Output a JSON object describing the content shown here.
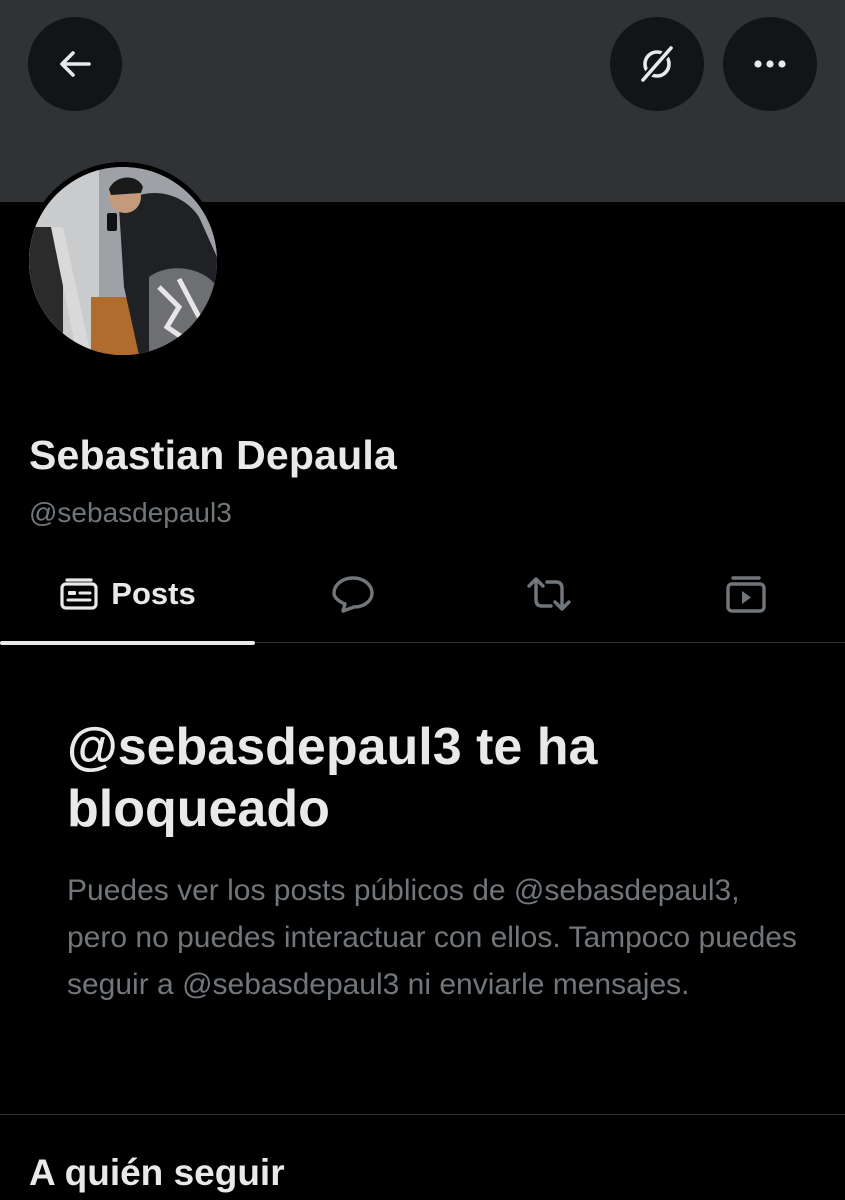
{
  "profile": {
    "display_name": "Sebastian Depaula",
    "handle": "@sebasdepaul3"
  },
  "header": {
    "back_icon": "arrow-left-icon",
    "grok_icon": "grok-icon",
    "more_icon": "more-horizontal-icon"
  },
  "tabs": [
    {
      "label": "Posts",
      "icon": "posts-icon",
      "active": true
    },
    {
      "label": "",
      "icon": "reply-icon",
      "active": false
    },
    {
      "label": "",
      "icon": "repost-icon",
      "active": false
    },
    {
      "label": "",
      "icon": "media-icon",
      "active": false
    }
  ],
  "blocked": {
    "title": "@sebasdepaul3 te ha bloqueado",
    "body": "Puedes ver los posts públicos de @sebasdepaul3, pero no puedes interactuar con ellos. Tampoco puedes seguir a @sebasdepaul3 ni enviarle mensajes."
  },
  "sections": {
    "who_to_follow": "A quién seguir"
  },
  "colors": {
    "background": "#000000",
    "banner": "#2f3336",
    "primary_text": "#e7e9ea",
    "secondary_text": "#71767b"
  }
}
